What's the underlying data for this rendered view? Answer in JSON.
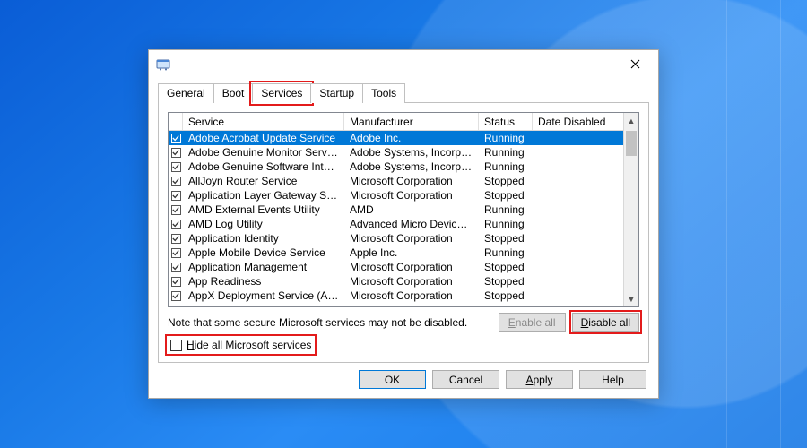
{
  "tabs": {
    "general": "General",
    "boot": "Boot",
    "services": "Services",
    "startup": "Startup",
    "tools": "Tools"
  },
  "columns": {
    "service": "Service",
    "manufacturer": "Manufacturer",
    "status": "Status",
    "date_disabled": "Date Disabled"
  },
  "rows": [
    {
      "svc": "Adobe Acrobat Update Service",
      "mfr": "Adobe Inc.",
      "stat": "Running"
    },
    {
      "svc": "Adobe Genuine Monitor Service",
      "mfr": "Adobe Systems, Incorpora...",
      "stat": "Running"
    },
    {
      "svc": "Adobe Genuine Software Integri...",
      "mfr": "Adobe Systems, Incorpora...",
      "stat": "Running"
    },
    {
      "svc": "AllJoyn Router Service",
      "mfr": "Microsoft Corporation",
      "stat": "Stopped"
    },
    {
      "svc": "Application Layer Gateway Service",
      "mfr": "Microsoft Corporation",
      "stat": "Stopped"
    },
    {
      "svc": "AMD External Events Utility",
      "mfr": "AMD",
      "stat": "Running"
    },
    {
      "svc": "AMD Log Utility",
      "mfr": "Advanced Micro Devices, I...",
      "stat": "Running"
    },
    {
      "svc": "Application Identity",
      "mfr": "Microsoft Corporation",
      "stat": "Stopped"
    },
    {
      "svc": "Apple Mobile Device Service",
      "mfr": "Apple Inc.",
      "stat": "Running"
    },
    {
      "svc": "Application Management",
      "mfr": "Microsoft Corporation",
      "stat": "Stopped"
    },
    {
      "svc": "App Readiness",
      "mfr": "Microsoft Corporation",
      "stat": "Stopped"
    },
    {
      "svc": "AppX Deployment Service (AppX...",
      "mfr": "Microsoft Corporation",
      "stat": "Stopped"
    }
  ],
  "note": "Note that some secure Microsoft services may not be disabled.",
  "buttons": {
    "enable_all": "nable all",
    "disable_all": "isable all",
    "ok": "OK",
    "cancel": "Cancel",
    "apply": "Apply",
    "help": "Help"
  },
  "hide_label_rest": "ide all Microsoft services"
}
